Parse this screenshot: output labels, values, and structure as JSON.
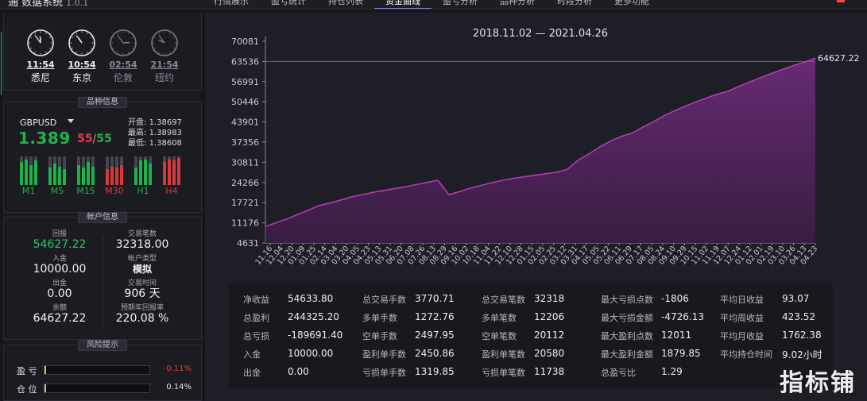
{
  "window": {
    "brand": "通 数据系统",
    "version": "1.0.1",
    "tabs": [
      "行情展示",
      "盈亏统计",
      "持仓列表",
      "资金曲线",
      "盈亏分析",
      "品种分析",
      "时段分析",
      "更多功能"
    ],
    "active_tab": 3,
    "accent_color": "#7d8bd8"
  },
  "clocks": [
    {
      "time": "11:54",
      "city": "悉尼",
      "state": "lit"
    },
    {
      "time": "10:54",
      "city": "东京",
      "state": "lit"
    },
    {
      "time": "02:54",
      "city": "伦敦",
      "state": "dim"
    },
    {
      "time": "21:54",
      "city": "纽约",
      "state": "dim"
    }
  ],
  "symbol": {
    "title": "品种信息",
    "name": "GBPUSD",
    "price": "1.389",
    "spread_ask": "55",
    "spread_sep": "/",
    "spread_bid": "55",
    "open_label": "开盘:",
    "open": "1.38697",
    "high_label": "最高:",
    "high": "1.38983",
    "low_label": "最低:",
    "low": "1.38608",
    "timeframes": [
      {
        "label": "M1",
        "color": "#1fb24a",
        "fill": [
          0.8,
          0.9,
          0.7,
          0.85
        ]
      },
      {
        "label": "M5",
        "color": "#1fb24a",
        "fill": [
          0.6,
          0.75,
          0.65,
          0.55
        ]
      },
      {
        "label": "M15",
        "color": "#1fb24a",
        "fill": [
          0.7,
          0.6,
          0.8,
          0.65
        ]
      },
      {
        "label": "M30",
        "color": "#d63a3a",
        "fill": [
          0.55,
          0.65,
          0.6,
          0.7
        ]
      },
      {
        "label": "H1",
        "color": "#1fb24a",
        "fill": [
          0.6,
          0.85,
          0.9,
          0.75
        ]
      },
      {
        "label": "H4",
        "color": "#d63a3a",
        "fill": [
          0.8,
          0.9,
          0.85,
          0.95
        ]
      }
    ],
    "up_color": "#1fb24a",
    "down_color": "#e23c3c"
  },
  "account": {
    "title": "帐户信息",
    "cells": [
      {
        "key": "回报",
        "value": "54627.22",
        "style": "green"
      },
      {
        "key": "交易笔数",
        "value": "32318.00",
        "style": ""
      },
      {
        "key": "入金",
        "value": "10000.00",
        "style": ""
      },
      {
        "key": "帐户类型",
        "value": "模拟",
        "style": "bold"
      },
      {
        "key": "出金",
        "value": "0.00",
        "style": ""
      },
      {
        "key": "交易时间",
        "value": "906 天",
        "style": ""
      },
      {
        "key": "余额",
        "value": "64627.22",
        "style": ""
      },
      {
        "key": "预期年回报率",
        "value": "220.08 %",
        "style": ""
      }
    ]
  },
  "risk": {
    "title": "风险提示",
    "rows": [
      {
        "label": "盈 亏",
        "value": "-0.11%",
        "fraction": 0.011,
        "color": "#e23c3c"
      },
      {
        "label": "仓 位",
        "value": "0.14%",
        "fraction": 0.014,
        "color": "#e0e0e6"
      }
    ]
  },
  "chart_data": {
    "type": "area",
    "title": "2018.11.02 — 2021.04.26",
    "y_ticks": [
      4631,
      11176,
      17721,
      24266,
      30811,
      37356,
      43901,
      50446,
      56991,
      63536,
      70081
    ],
    "ylim": [
      4631,
      70081
    ],
    "x_tick_labels": [
      "11.16",
      "12.04",
      "12.20",
      "01.09",
      "01.25",
      "02.14",
      "03.04",
      "03.20",
      "04.05",
      "04.23",
      "05.09",
      "05.31",
      "06.20",
      "07.08",
      "07.26",
      "08.13",
      "08.29",
      "09.16",
      "10.02",
      "10.18",
      "11.04",
      "11.22",
      "12.10",
      "12.28",
      "01.15",
      "02.03",
      "02.25",
      "03.12",
      "03.31",
      "04.17",
      "05.05",
      "05.24",
      "06.11",
      "06.30",
      "07.19",
      "08.06",
      "08.24",
      "09.10",
      "09.28",
      "10.15",
      "11.02",
      "11.19",
      "12.07",
      "12.24",
      "01.13",
      "02.02",
      "02.19",
      "03.10",
      "03.26",
      "04.13"
    ],
    "x_tick_labels_b": [
      "11.16",
      "12.04",
      "12.20",
      "01.09",
      "01.25",
      "02.14",
      "03.04",
      "03.20",
      "04.05",
      "04.23",
      "05.13",
      "05.31",
      "06.20",
      "07.08",
      "07.26",
      "08.13",
      "08.29",
      "09.16",
      "10.02",
      "10.18",
      "11.04",
      "11.22",
      "12.10",
      "12.28",
      "01.15",
      "02.05",
      "02.25",
      "03.12",
      "03.31",
      "04.17",
      "05.05",
      "05.22",
      "06.11",
      "06.29",
      "07.17",
      "08.05",
      "08.24",
      "09.10",
      "09.29",
      "10.15",
      "11.02",
      "11.19",
      "12.07",
      "12.24",
      "01.12",
      "02.01",
      "02.19",
      "03.10",
      "03.26",
      "04.13"
    ],
    "x_tick_labels_c": [
      "11.16",
      "12.04",
      "12.20",
      "01.09",
      "01.25",
      "02.14",
      "03.04",
      "03.20",
      "04.05",
      "04.23",
      "05.13",
      "05.31",
      "06.20",
      "07.08",
      "07.26",
      "08.13",
      "08.29",
      "09.16",
      "10.02",
      "10.18",
      "11.04",
      "11.22",
      "12.10",
      "12.28",
      "01.15",
      "02.05",
      "02.25",
      "03.12",
      "03.31",
      "04.17",
      "05.05",
      "05.22",
      "06.11",
      "06.29",
      "07.17",
      "08.05",
      "08.24",
      "09.10",
      "09.29",
      "10.15",
      "11.02",
      "11.19",
      "12.07",
      "12.24",
      "01.12",
      "02.01",
      "02.19",
      "03.10",
      "03.26",
      "04.13"
    ],
    "x_labels_shown": [
      "11.16",
      "12.04",
      "12.20",
      "01.09",
      "01.25",
      "02.14",
      "03.04",
      "03.20",
      "04.05",
      "04.23",
      "05.13",
      "05.31",
      "06.20",
      "07.08",
      "07.26",
      "08.13",
      "08.29",
      "09.16",
      "10.02",
      "10.18",
      "11.04",
      "11.22",
      "12.10",
      "12.28",
      "01.15",
      "02.05",
      "02.25",
      "03.12",
      "03.31",
      "04.17",
      "05.05",
      "05.22",
      "06.11",
      "06.29",
      "07.17",
      "08.05",
      "08.24",
      "09.10",
      "09.29",
      "10.15",
      "11.02",
      "11.19",
      "12.07",
      "12.24",
      "01.12",
      "02.01",
      "02.19",
      "03.10",
      "03.26",
      "04.13"
    ],
    "x_tick_labels_final": [
      "11.16",
      "12.04",
      "12.20",
      "01.09",
      "01.25",
      "02.14",
      "03.04",
      "03.20",
      "04.05",
      "04.23",
      "05.13",
      "05.31",
      "06.20",
      "07.08",
      "07.26",
      "08.13",
      "08.29",
      "09.16",
      "10.02",
      "10.18",
      "11.04",
      "11.22",
      "12.10",
      "12.28",
      "01.15",
      "02.05",
      "02.25",
      "03.12",
      "03.31",
      "04.17",
      "05.05",
      "05.22",
      "06.11",
      "06.29",
      "07.17",
      "08.05",
      "08.24",
      "09.10",
      "09.29",
      "10.15",
      "11.02",
      "11.19",
      "12.07",
      "12.24",
      "01.12",
      "02.01",
      "02.19",
      "03.10",
      "03.26",
      "04.13"
    ],
    "x_tick_labels_visible": [
      "11.16",
      "12.04",
      "12.20",
      "01.09",
      "01.25",
      "02.14",
      "03.04",
      "03.20",
      "04.05",
      "04.23",
      "05.13",
      "05.31",
      "06.20",
      "07.08",
      "07.26",
      "08.13",
      "08.29",
      "09.16",
      "10.02",
      "10.18",
      "11.04",
      "11.22",
      "12.10",
      "12.28",
      "01.15",
      "02.05",
      "02.25",
      "03.12",
      "03.31",
      "04.17",
      "05.05",
      "05.22",
      "06.11",
      "06.29",
      "07.17",
      "08.05",
      "08.24",
      "09.10",
      "09.29",
      "10.15",
      "11.02",
      "11.19",
      "12.07",
      "12.24",
      "01.12",
      "02.01",
      "02.19",
      "03.10",
      "03.26",
      "04.13"
    ],
    "x_tick_labels_screen": [
      "11.16",
      "12.04",
      "12.20",
      "01.09",
      "01.25",
      "02.14",
      "03.04",
      "03.20",
      "04.05",
      "04.23",
      "05.13",
      "05.31",
      "06.20",
      "07.08",
      "07.26",
      "08.13",
      "08.29",
      "09.16",
      "10.02",
      "10.18",
      "11.04",
      "11.22",
      "12.10",
      "12.28",
      "01.15",
      "02.05",
      "02.25",
      "03.12",
      "03.31",
      "04.17",
      "05.05",
      "05.22",
      "06.11",
      "06.29",
      "07.17",
      "08.05",
      "08.24",
      "09.10",
      "09.29",
      "10.15",
      "11.02",
      "11.19",
      "12.07",
      "12.24",
      "01.12",
      "02.01",
      "02.19",
      "03.10",
      "03.26",
      "04.13"
    ],
    "x_ticks": [
      "11.16",
      "12.04",
      "12.20",
      "01.09",
      "01.25",
      "02.14",
      "03.04",
      "03.20",
      "04.05",
      "04.23",
      "05.13",
      "05.31",
      "06.20",
      "07.08",
      "07.26",
      "08.13",
      "08.29",
      "09.16",
      "10.02",
      "10.18",
      "11.04",
      "11.22",
      "12.10",
      "12.28",
      "01.15",
      "02.05",
      "02.25",
      "03.12",
      "03.31",
      "04.17",
      "05.05",
      "05.22",
      "06.11",
      "06.29",
      "07.17",
      "08.05",
      "08.24",
      "09.10",
      "09.29",
      "10.15",
      "11.02",
      "11.19",
      "12.07",
      "12.24",
      "01.12",
      "02.01",
      "02.19",
      "03.10",
      "03.26",
      "04.13",
      "04.23"
    ],
    "x_label_final": "04.23",
    "y": [
      10000,
      11200,
      12400,
      13900,
      15300,
      16800,
      17600,
      18600,
      19600,
      20300,
      21100,
      21700,
      22300,
      22900,
      23600,
      24300,
      25000,
      20300,
      21300,
      22400,
      23300,
      24200,
      25000,
      25600,
      26100,
      26600,
      27100,
      27600,
      28500,
      31500,
      33500,
      35800,
      37700,
      39200,
      40300,
      42200,
      44000,
      46000,
      47600,
      49100,
      50500,
      51800,
      53000,
      54000,
      55600,
      57000,
      58400,
      59700,
      61000,
      62300,
      63300,
      64627.22
    ],
    "end_label": "64627.22",
    "line_color": "#b53ab7",
    "fill_color": "#4e2257",
    "ref_line_value": 63536,
    "ref_line_color": "#8e4c95"
  },
  "stats": {
    "columns": [
      [
        [
          "净收益",
          "54633.80"
        ],
        [
          "总盈利",
          "244325.20"
        ],
        [
          "总亏损",
          "-189691.40"
        ],
        [
          "入金",
          "10000.00"
        ],
        [
          "出金",
          "0.00"
        ]
      ],
      [
        [
          "总交易手数",
          "3770.71"
        ],
        [
          "多单手数",
          "1272.76"
        ],
        [
          "空单手数",
          "2497.95"
        ],
        [
          "盈利单手数",
          "2450.86"
        ],
        [
          "亏损单手数",
          "1319.85"
        ]
      ],
      [
        [
          "总交易笔数",
          "32318"
        ],
        [
          "多单笔数",
          "12206"
        ],
        [
          "空单笔数",
          "20112"
        ],
        [
          "盈利单笔数",
          "20580"
        ],
        [
          "亏损单笔数",
          "11738"
        ]
      ],
      [
        [
          "最大亏损点数",
          "-1806"
        ],
        [
          "最大亏损金额",
          "-4726.13"
        ],
        [
          "最大盈利点数",
          "12011"
        ],
        [
          "最大盈利金额",
          "1879.85"
        ],
        [
          "总盈亏比",
          "1.29"
        ]
      ],
      [
        [
          "平均日收益",
          "93.07"
        ],
        [
          "平均周收益",
          "423.52"
        ],
        [
          "平均月收益",
          "1762.38"
        ],
        [
          "平均持仓时间",
          "9.02小时"
        ]
      ]
    ]
  },
  "watermark": "指标铺"
}
